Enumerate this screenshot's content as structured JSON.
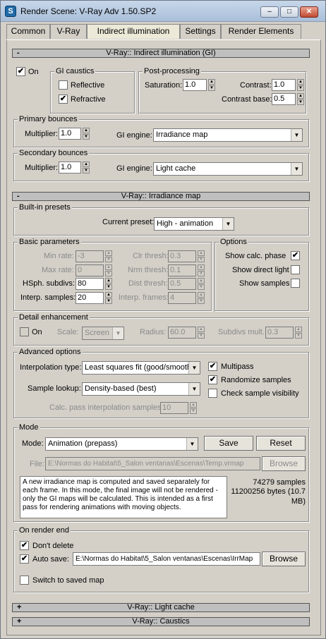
{
  "window": {
    "title": "Render Scene: V-Ray Adv 1.50.SP2",
    "app_icon": "S"
  },
  "caption": {
    "min": "–",
    "max": "□",
    "close": "✕"
  },
  "tabs": [
    "Common",
    "V-Ray",
    "Indirect illumination",
    "Settings",
    "Render Elements"
  ],
  "gi": {
    "rollout_sign": "-",
    "rollout_title": "V-Ray:: Indirect illumination (GI)",
    "on_label": "On",
    "on_check": "✔",
    "caustics": {
      "title": "GI caustics",
      "reflective": "Reflective",
      "refractive": "Refractive",
      "refractive_check": "✔"
    },
    "post": {
      "title": "Post-processing",
      "saturation_label": "Saturation:",
      "saturation": "1.0",
      "contrast_label": "Contrast:",
      "contrast": "1.0",
      "contrast_base_label": "Contrast base:",
      "contrast_base": "0.5"
    },
    "primary": {
      "title": "Primary bounces",
      "multiplier_label": "Multiplier:",
      "multiplier": "1.0",
      "engine_label": "GI engine:",
      "engine": "Irradiance map"
    },
    "secondary": {
      "title": "Secondary bounces",
      "multiplier_label": "Multiplier:",
      "multiplier": "1.0",
      "engine_label": "GI engine:",
      "engine": "Light cache"
    }
  },
  "irr": {
    "rollout_sign": "-",
    "rollout_title": "V-Ray:: Irradiance map",
    "presets": {
      "title": "Built-in presets",
      "current_label": "Current preset:",
      "current": "High - animation"
    },
    "basic": {
      "title": "Basic parameters",
      "min_rate_label": "Min rate:",
      "min_rate": "-3",
      "max_rate_label": "Max rate:",
      "max_rate": "0",
      "hsph_label": "HSph. subdivs:",
      "hsph": "80",
      "interp_label": "Interp. samples:",
      "interp": "20",
      "clr_label": "Clr thresh:",
      "clr": "0.3",
      "nrm_label": "Nrm thresh:",
      "nrm": "0.1",
      "dist_label": "Dist thresh:",
      "dist": "0.5",
      "frames_label": "Interp. frames:",
      "frames": "4"
    },
    "options": {
      "title": "Options",
      "show_phase": "Show calc. phase",
      "show_phase_check": "✔",
      "show_direct": "Show direct light",
      "show_samples": "Show samples"
    },
    "detail": {
      "title": "Detail enhancement",
      "on_label": "On",
      "scale_label": "Scale:",
      "scale": "Screen",
      "radius_label": "Radius:",
      "radius": "60.0",
      "subdivs_label": "Subdivs mult.",
      "subdivs": "0.3"
    },
    "advanced": {
      "title": "Advanced options",
      "interp_type_label": "Interpolation type:",
      "interp_type": "Least squares fit (good/smooth",
      "lookup_label": "Sample lookup:",
      "lookup": "Density-based (best)",
      "calc_label": "Calc. pass interpolation samples:",
      "calc": "10",
      "multipass": "Multipass",
      "multipass_check": "✔",
      "randomize": "Randomize samples",
      "randomize_check": "✔",
      "check_vis": "Check sample visibility"
    },
    "mode": {
      "title": "Mode",
      "mode_label": "Mode:",
      "mode": "Animation (prepass)",
      "save": "Save",
      "reset": "Reset",
      "file_label": "File:",
      "file": "E:\\Normas do Habitat\\5_Salon ventanas\\Escenas\\Temp.vrmap",
      "browse": "Browse",
      "info": "A new irradiance map is computed and saved separately for each frame. In this mode, the final image will not be rendered - only the GI maps will be calculated. This is intended as a first pass for rendering animations with moving objects.",
      "samples": "74279 samples",
      "bytes": "11200256 bytes (10.7 MB)"
    },
    "end": {
      "title": "On render end",
      "dont_delete": "Don't delete",
      "dont_delete_check": "✔",
      "auto_save": "Auto save:",
      "auto_save_check": "✔",
      "path": "E:\\Normas do Habitat\\5_Salon ventanas\\Escenas\\IrrMap",
      "browse": "Browse",
      "switch": "Switch to saved map"
    }
  },
  "collapsed": [
    {
      "sign": "+",
      "title": "V-Ray:: Light cache"
    },
    {
      "sign": "+",
      "title": "V-Ray:: Caustics"
    }
  ]
}
